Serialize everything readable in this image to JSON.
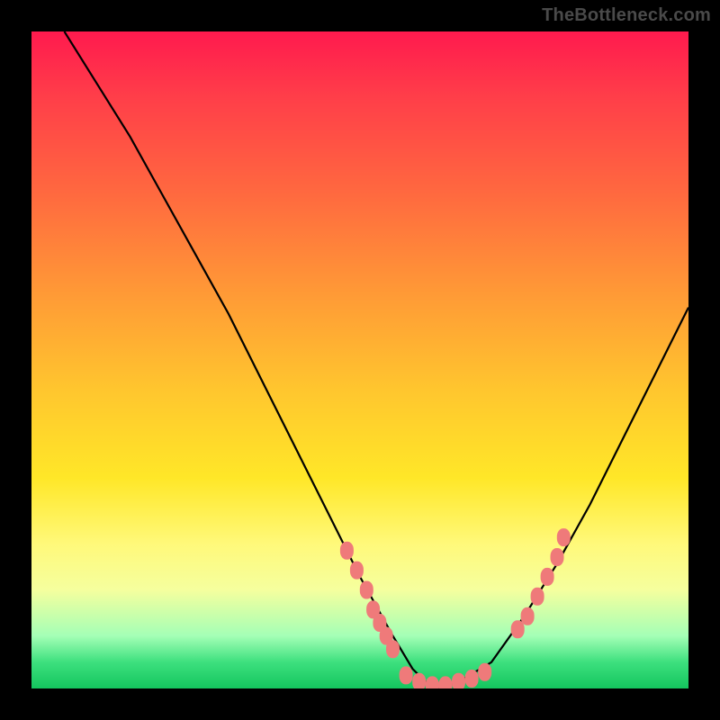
{
  "watermark": "TheBottleneck.com",
  "chart_data": {
    "type": "line",
    "title": "",
    "xlabel": "",
    "ylabel": "",
    "xlim": [
      0,
      100
    ],
    "ylim": [
      0,
      100
    ],
    "grid": false,
    "series": [
      {
        "name": "curve",
        "color": "#000000",
        "x": [
          5,
          10,
          15,
          20,
          25,
          30,
          35,
          40,
          45,
          50,
          55,
          58,
          60,
          62,
          65,
          70,
          75,
          80,
          85,
          90,
          95,
          100
        ],
        "y": [
          100,
          92,
          84,
          75,
          66,
          57,
          47,
          37,
          27,
          17,
          8,
          3,
          1,
          0,
          1,
          4,
          11,
          19,
          28,
          38,
          48,
          58
        ]
      },
      {
        "name": "left-dots",
        "color": "#ef7a7a",
        "marker": "round-rect",
        "x": [
          48,
          49.5,
          51,
          52,
          53,
          54,
          55
        ],
        "y": [
          21,
          18,
          15,
          12,
          10,
          8,
          6
        ]
      },
      {
        "name": "bottom-dots",
        "color": "#ef7a7a",
        "marker": "round-rect",
        "x": [
          57,
          59,
          61,
          63,
          65,
          67,
          69
        ],
        "y": [
          2,
          1,
          0.5,
          0.5,
          1,
          1.5,
          2.5
        ]
      },
      {
        "name": "right-dots",
        "color": "#ef7a7a",
        "marker": "round-rect",
        "x": [
          74,
          75.5,
          77,
          78.5,
          80,
          81
        ],
        "y": [
          9,
          11,
          14,
          17,
          20,
          23
        ]
      }
    ],
    "colors": {
      "gradient_top": "#ff1a4e",
      "gradient_mid": "#ffe728",
      "gradient_bottom": "#14c55e",
      "curve": "#000000",
      "dots": "#ef7a7a",
      "frame": "#000000"
    }
  }
}
